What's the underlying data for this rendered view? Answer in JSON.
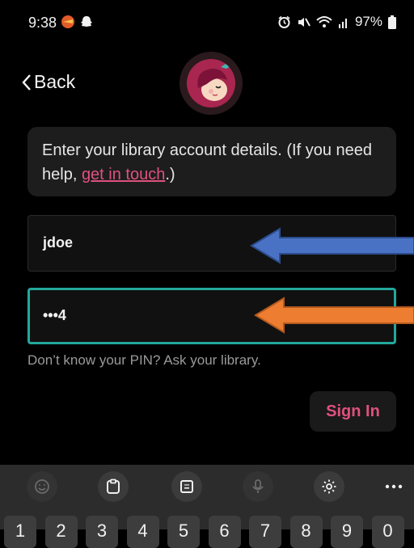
{
  "status_bar": {
    "time": "9:38",
    "battery": "97%"
  },
  "header": {
    "back_label": "Back"
  },
  "info": {
    "text_before": "Enter your library account details. (If you need help, ",
    "link": "get in touch",
    "text_after": ".)"
  },
  "form": {
    "username": "jdoe",
    "pin_masked": "•••4",
    "pin_hint": "Don’t know your PIN? Ask your library.",
    "sign_in_label": "Sign In"
  },
  "keyboard": {
    "toolbar": [
      "emoji-icon",
      "clipboard-icon",
      "keypad-icon",
      "microphone-icon",
      "settings-icon",
      "more-icon"
    ],
    "number_keys": [
      "1",
      "2",
      "3",
      "4",
      "5",
      "6",
      "7",
      "8",
      "9",
      "0"
    ]
  },
  "annotations": {
    "arrow_1_color": "#4a72c4",
    "arrow_2_color": "#ed7d31",
    "accent_color": "#e0507f",
    "focus_color": "#23a89c"
  }
}
